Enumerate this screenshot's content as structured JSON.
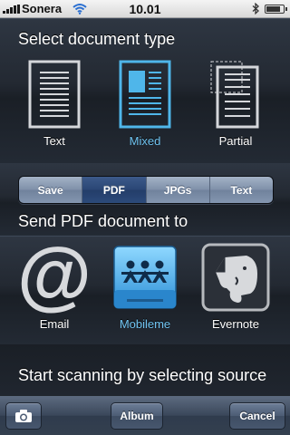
{
  "status": {
    "carrier": "Sonera",
    "time": "10.01",
    "battery_level": 0.85,
    "icons": [
      "signal-icon",
      "wifi-icon",
      "bluetooth-icon",
      "battery-icon"
    ]
  },
  "document_type": {
    "title": "Select document type",
    "options": [
      {
        "label": "Text",
        "icon": "text-document-icon",
        "selected": false
      },
      {
        "label": "Mixed",
        "icon": "mixed-document-icon",
        "selected": true
      },
      {
        "label": "Partial",
        "icon": "partial-document-icon",
        "selected": false
      }
    ]
  },
  "format": {
    "options": [
      "Save",
      "PDF",
      "JPGs",
      "Text"
    ],
    "selected": "PDF"
  },
  "destination": {
    "title": "Send PDF document to",
    "options": [
      {
        "label": "Email",
        "icon": "at-sign-icon",
        "selected": false
      },
      {
        "label": "Mobileme",
        "icon": "mobileme-icon",
        "selected": true
      },
      {
        "label": "Evernote",
        "icon": "evernote-elephant-icon",
        "selected": false
      }
    ]
  },
  "source": {
    "title": "Start scanning by selecting source"
  },
  "toolbar": {
    "camera_icon": "camera-icon",
    "album_label": "Album",
    "cancel_label": "Cancel"
  },
  "colors": {
    "selected_text": "#6fc3f0",
    "segment_active": "#2a4675",
    "segment_inactive": "#7f90a9"
  }
}
